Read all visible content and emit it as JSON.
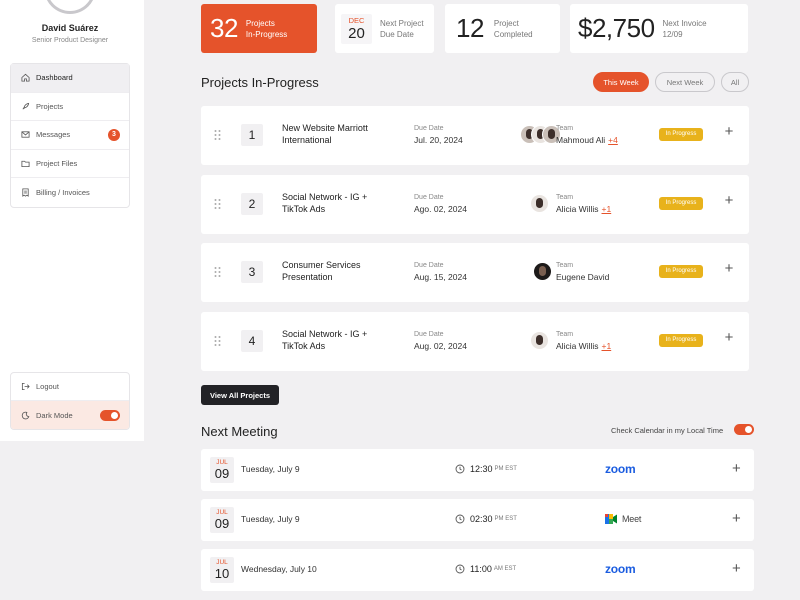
{
  "profile": {
    "name": "David Suárez",
    "role": "Senior Product Designer"
  },
  "nav": {
    "items": [
      {
        "label": "Dashboard",
        "icon": "home-icon",
        "active": true
      },
      {
        "label": "Projects",
        "icon": "rocket-icon"
      },
      {
        "label": "Messages",
        "icon": "mail-icon",
        "badge": "3"
      },
      {
        "label": "Project Files",
        "icon": "folder-icon"
      },
      {
        "label": "Billing / Invoices",
        "icon": "receipt-icon"
      }
    ],
    "logout_label": "Logout",
    "dark_mode_label": "Dark Mode"
  },
  "stats": {
    "in_progress_count": "32",
    "in_progress_label_1": "Projects",
    "in_progress_label_2": "In-Progress",
    "next_due_month": "DEC",
    "next_due_day": "20",
    "next_due_label_1": "Next Project",
    "next_due_label_2": "Due Date",
    "completed_count": "12",
    "completed_label_1": "Project",
    "completed_label_2": "Completed",
    "invoice_amount": "$2,750",
    "invoice_label_1": "Next Invoice",
    "invoice_label_2": "12/09"
  },
  "projects_section": {
    "title": "Projects In-Progress",
    "filters": [
      "This Week",
      "Next Week",
      "All"
    ],
    "active_filter": "This Week",
    "due_label": "Due Date",
    "team_label": "Team",
    "status_label": "In Progress",
    "view_all_label": "View All Projects",
    "rows": [
      {
        "num": "1",
        "name": "New Website Marriott International",
        "due": "Jul. 20, 2024",
        "team_lead": "Mahmoud Ali",
        "team_more": "+4"
      },
      {
        "num": "2",
        "name": "Social Network - IG + TikTok Ads",
        "due": "Ago. 02, 2024",
        "team_lead": "Alicia Willis",
        "team_more": "+1"
      },
      {
        "num": "3",
        "name": "Consumer Services Presentation",
        "due": "Aug. 15, 2024",
        "team_lead": "Eugene David",
        "team_more": ""
      },
      {
        "num": "4",
        "name": "Social Network - IG + TikTok Ads",
        "due": "Aug. 02, 2024",
        "team_lead": "Alicia Willis",
        "team_more": "+1"
      }
    ]
  },
  "meetings_section": {
    "title": "Next Meeting",
    "calendar_toggle_label": "Check Calendar in my Local Time",
    "rows": [
      {
        "month": "JUL",
        "day": "09",
        "weekday_date": "Tuesday, July 9",
        "time": "12:30",
        "ampm": "PM EST",
        "app": "zoom"
      },
      {
        "month": "JUL",
        "day": "09",
        "weekday_date": "Tuesday, July 9",
        "time": "02:30",
        "ampm": "PM EST",
        "app": "Meet"
      },
      {
        "month": "JUL",
        "day": "10",
        "weekday_date": "Wednesday, July 10",
        "time": "11:00",
        "ampm": "AM EST",
        "app": "zoom"
      }
    ]
  },
  "colors": {
    "accent": "#e5532b",
    "status_yellow": "#e8b21b",
    "zoom_blue": "#1a5ce0"
  }
}
